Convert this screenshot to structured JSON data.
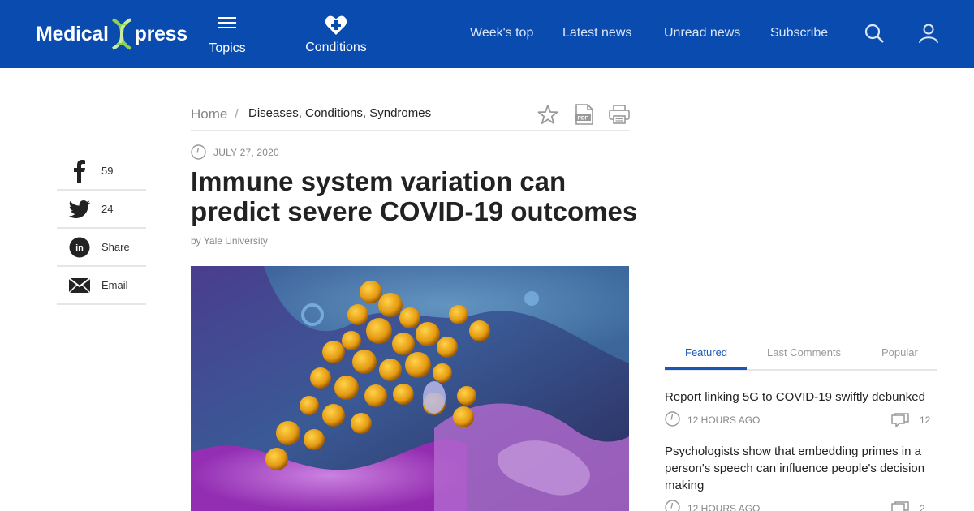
{
  "header": {
    "logo_left": "Medical",
    "logo_right": "press",
    "topics_label": "Topics",
    "conditions_label": "Conditions",
    "links": [
      "Week's top",
      "Latest news",
      "Unread news",
      "Subscribe"
    ],
    "bg_color": "#0a4bb0"
  },
  "share": [
    {
      "icon": "facebook-icon",
      "label": "59"
    },
    {
      "icon": "twitter-icon",
      "label": "24"
    },
    {
      "icon": "linkedin-icon",
      "label": "Share"
    },
    {
      "icon": "email-icon",
      "label": "Email"
    }
  ],
  "breadcrumb": {
    "home": "Home",
    "separator": "/",
    "category": "Diseases, Conditions, Syndromes"
  },
  "article": {
    "date": "JULY 27, 2020",
    "title": "Immune system variation can predict severe COVID-19 outcomes",
    "byline": "by Yale University"
  },
  "sidebar": {
    "tabs": [
      "Featured",
      "Last Comments",
      "Popular"
    ],
    "active_tab": "Featured",
    "accent_color": "#1a56b8",
    "stories": [
      {
        "title": "Report linking 5G to COVID-19 swiftly debunked",
        "age": "12 HOURS AGO",
        "comments": "12"
      },
      {
        "title": "Psychologists show that embedding primes in a person's speech can influence people's decision making",
        "age": "12 HOURS AGO",
        "comments": "2"
      }
    ]
  }
}
